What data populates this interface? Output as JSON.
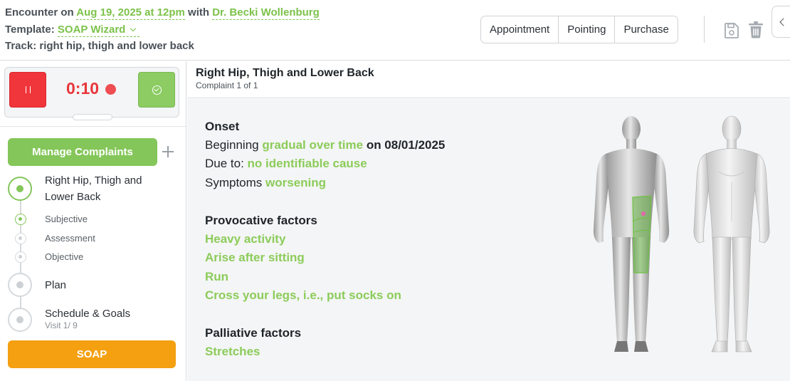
{
  "header": {
    "encounter_prefix": "Encounter on",
    "encounter_date": "Aug 19, 2025 at 12pm",
    "encounter_with": "with",
    "encounter_doctor": "Dr. Becki Wollenburg",
    "template_label": "Template:",
    "template_value": "SOAP Wizard",
    "track_label": "Track: right hip, thigh and lower back",
    "buttons": [
      "Appointment",
      "Pointing",
      "Purchase"
    ],
    "icons": {
      "save": "save-icon",
      "delete": "trash-icon",
      "collapse": "chevron-left-icon"
    }
  },
  "timer": {
    "time": "0:10",
    "pause_icon": "pause-icon",
    "done_icon": "check-circle-icon",
    "recording_color": "#ee4d52"
  },
  "sidebar": {
    "manage_label": "Manage Complaints",
    "complaint_label_line1": "Right Hip, Thigh and",
    "complaint_label_line2": "Lower Back",
    "steps": [
      "Subjective",
      "Assessment",
      "Objective"
    ],
    "plan_label": "Plan",
    "schedule_label": "Schedule & Goals",
    "schedule_note": "Visit 1/ 9",
    "soap_label": "SOAP"
  },
  "main": {
    "title": "Right Hip, Thigh and Lower Back",
    "subtitle": "Complaint 1 of 1",
    "onset_heading": "Onset",
    "beginning_prefix": "Beginning",
    "beginning_value": "gradual over time",
    "beginning_suffix": "on 08/01/2025",
    "due_prefix": "Due to:",
    "due_value": "no identifiable cause",
    "symptoms_prefix": "Symptoms",
    "symptoms_value": "worsening",
    "provocative_heading": "Provocative factors",
    "provocative": [
      "Heavy activity",
      "Arise after sitting",
      "Run",
      "Cross your legs, i.e., put socks on"
    ],
    "palliative_heading": "Palliative factors",
    "palliative": [
      "Stretches"
    ]
  },
  "colors": {
    "accent_green": "#84c65a",
    "link_green": "#7cc24a",
    "soap_orange": "#f4a011",
    "stop_red": "#f0353b"
  }
}
